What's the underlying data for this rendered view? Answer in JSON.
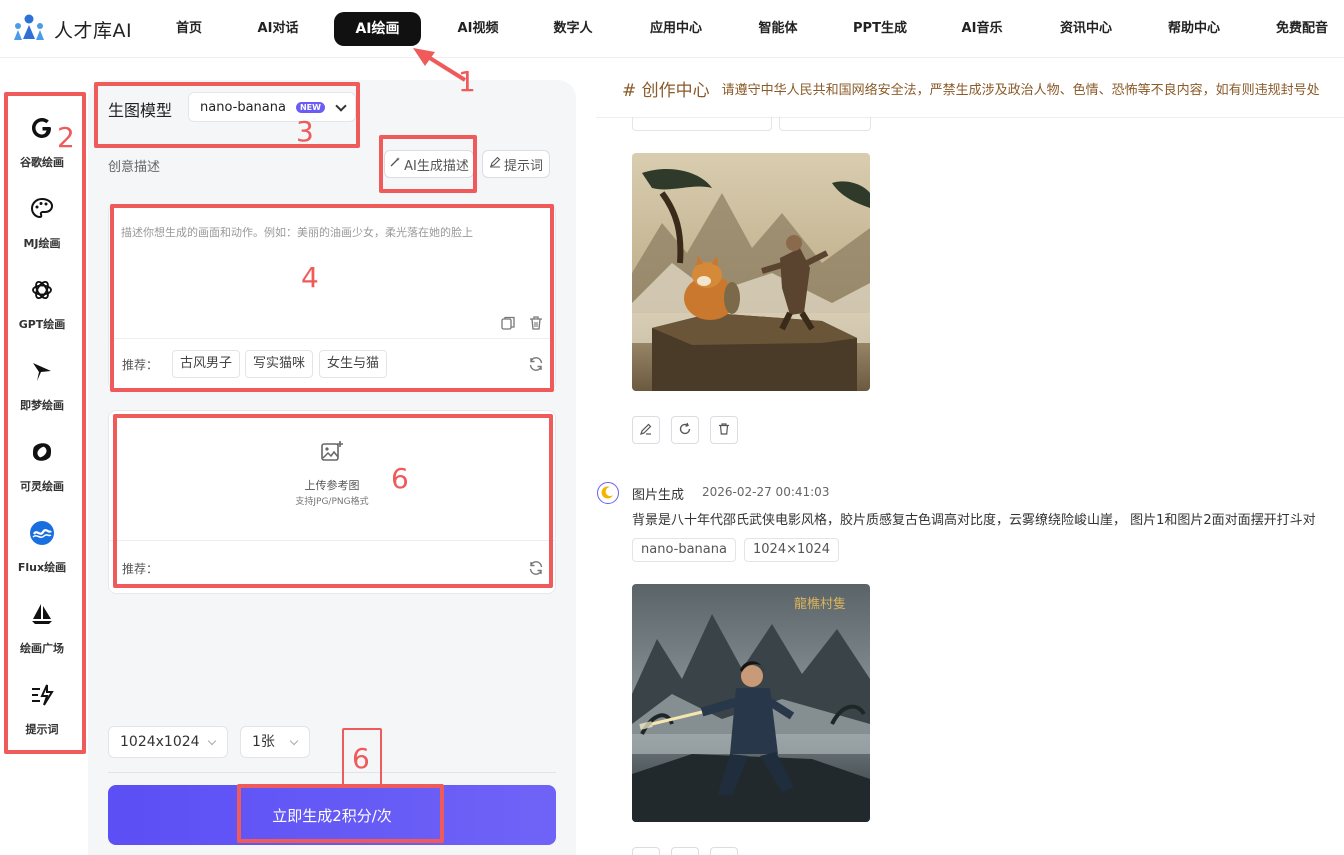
{
  "brand": {
    "name": "人才库AI"
  },
  "nav": {
    "items": [
      {
        "label": "首页"
      },
      {
        "label": "AI对话"
      },
      {
        "label": "AI绘画"
      },
      {
        "label": "AI视频"
      },
      {
        "label": "数字人"
      },
      {
        "label": "应用中心"
      },
      {
        "label": "智能体"
      },
      {
        "label": "PPT生成"
      },
      {
        "label": "AI音乐"
      },
      {
        "label": "资讯中心"
      },
      {
        "label": "帮助中心"
      },
      {
        "label": "免费配音"
      }
    ],
    "active_index": 2
  },
  "rail": {
    "items": [
      {
        "label": "谷歌绘画",
        "icon": "google-icon"
      },
      {
        "label": "MJ绘画",
        "icon": "palette-icon"
      },
      {
        "label": "GPT绘画",
        "icon": "openai-icon"
      },
      {
        "label": "即梦绘画",
        "icon": "jimeng-icon"
      },
      {
        "label": "可灵绘画",
        "icon": "kling-icon"
      },
      {
        "label": "Flux绘画",
        "icon": "flux-icon"
      },
      {
        "label": "绘画广场",
        "icon": "sailboat-icon"
      },
      {
        "label": "提示词",
        "icon": "prompt-spark-icon"
      }
    ]
  },
  "panel": {
    "model_label": "生图模型",
    "model_value": "nano-banana",
    "model_badge": "NEW",
    "desc_label": "创意描述",
    "ai_desc_button": "AI生成描述",
    "prompt_button": "提示词",
    "prompt_placeholder": "描述你想生成的画面和动作。例如：美丽的油画少女，柔光落在她的脸上",
    "recommend_label": "推荐：",
    "recommend_tags": [
      "古风男子",
      "写实猫咪",
      "女生与猫"
    ],
    "upload_title": "上传参考图",
    "upload_sub": "支持JPG/PNG格式",
    "upload_recommend_label": "推荐：",
    "size_value": "1024x1024",
    "count_value": "1张",
    "generate_button": "立即生成2积分/次"
  },
  "annotations": [
    "1",
    "2",
    "3",
    "4",
    "6",
    "6"
  ],
  "creation": {
    "title": "# 创作中心",
    "notice": "请遵守中华人民共和国网络安全法，严禁生成涉及政治人物、色情、恐怖等不良内容，如有则违规封号处",
    "record": {
      "type": "图片生成",
      "time": "2026-02-27 00:41:03",
      "prompt": "背景是八十年代邵氏武侠电影风格，胶片质感复古色调高对比度，云雾缭绕险峻山崖，  图片1和图片2面对面摆开打斗对",
      "model": "nano-banana",
      "size": "1024×1024",
      "image_caption": "龍樵村隻"
    }
  },
  "colors": {
    "accent": "#5b4ff5",
    "annotation_red": "#ef5a5a",
    "notice_brown": "#8a5a28"
  }
}
